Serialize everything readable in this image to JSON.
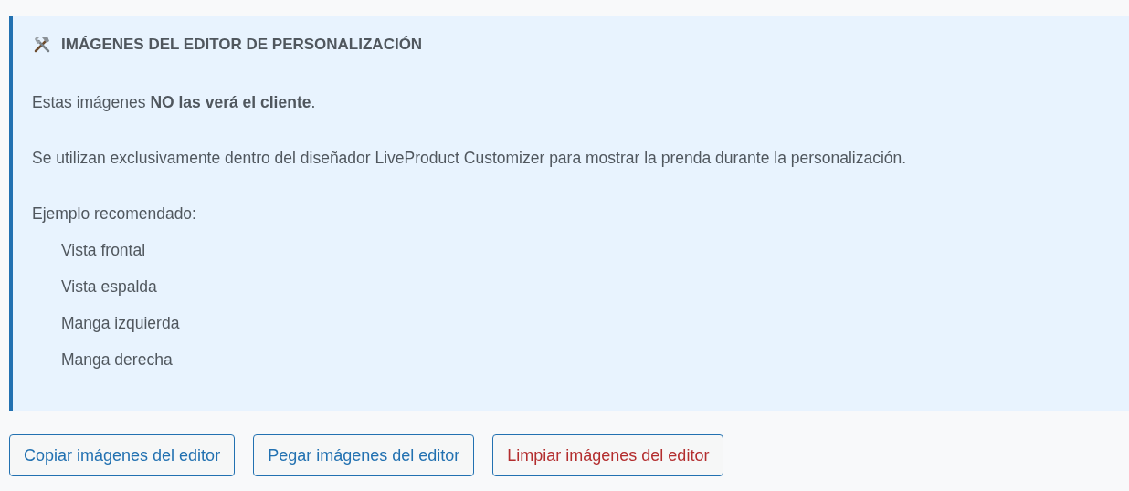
{
  "notice": {
    "title": "IMÁGENES DEL EDITOR DE PERSONALIZACIÓN",
    "paragraphs": [
      "Estas imágenes **NO las verá el cliente**.",
      "Se utilizan exclusivamente dentro del diseñador LiveProduct Customizer para mostrar la prenda durante la personalización.",
      "Ejemplo recomendado:"
    ],
    "examples": [
      "Vista frontal",
      "Vista espalda",
      "Manga izquierda",
      "Manga derecha"
    ]
  },
  "buttons": [
    {
      "label": "Copiar imágenes del editor",
      "kind": "normal"
    },
    {
      "label": "Pegar imágenes del editor",
      "kind": "normal"
    },
    {
      "label": "Limpiar imágenes del editor",
      "kind": "danger"
    }
  ]
}
